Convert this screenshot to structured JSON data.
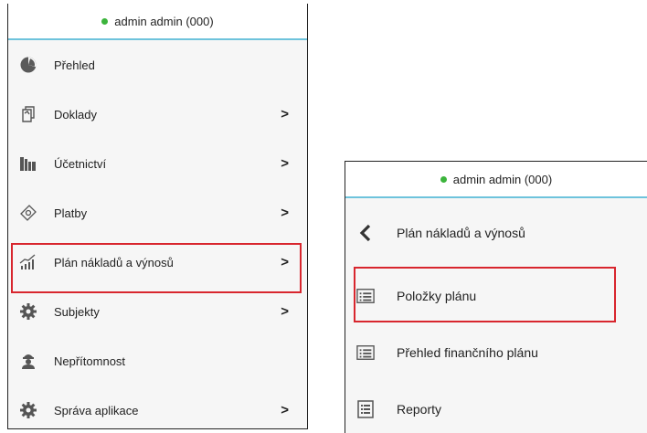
{
  "user": {
    "label": "admin admin (000)",
    "status_color": "#3cb43c"
  },
  "highlight_color": "#d8262e",
  "left_menu": {
    "items": [
      {
        "label": "Přehled",
        "icon": "pie-chart-icon",
        "has_submenu": false
      },
      {
        "label": "Doklady",
        "icon": "documents-icon",
        "has_submenu": true
      },
      {
        "label": "Účetnictví",
        "icon": "books-icon",
        "has_submenu": true
      },
      {
        "label": "Platby",
        "icon": "payment-tag-icon",
        "has_submenu": true
      },
      {
        "label": "Plán nákladů a výnosů",
        "icon": "growth-chart-icon",
        "has_submenu": true,
        "highlighted": true
      },
      {
        "label": "Subjekty",
        "icon": "gear-icon",
        "has_submenu": true
      },
      {
        "label": "Nepřítomnost",
        "icon": "absence-icon",
        "has_submenu": false
      },
      {
        "label": "Správa aplikace",
        "icon": "gear-icon",
        "has_submenu": true
      }
    ]
  },
  "right_menu": {
    "back_label": "Plán nákladů a výnosů",
    "items": [
      {
        "label": "Položky plánu",
        "icon": "list-icon",
        "highlighted": true
      },
      {
        "label": "Přehled finančního plánu",
        "icon": "list-icon"
      },
      {
        "label": "Reporty",
        "icon": "report-icon"
      }
    ]
  },
  "chevron_glyph": ">",
  "back_glyph": "<"
}
